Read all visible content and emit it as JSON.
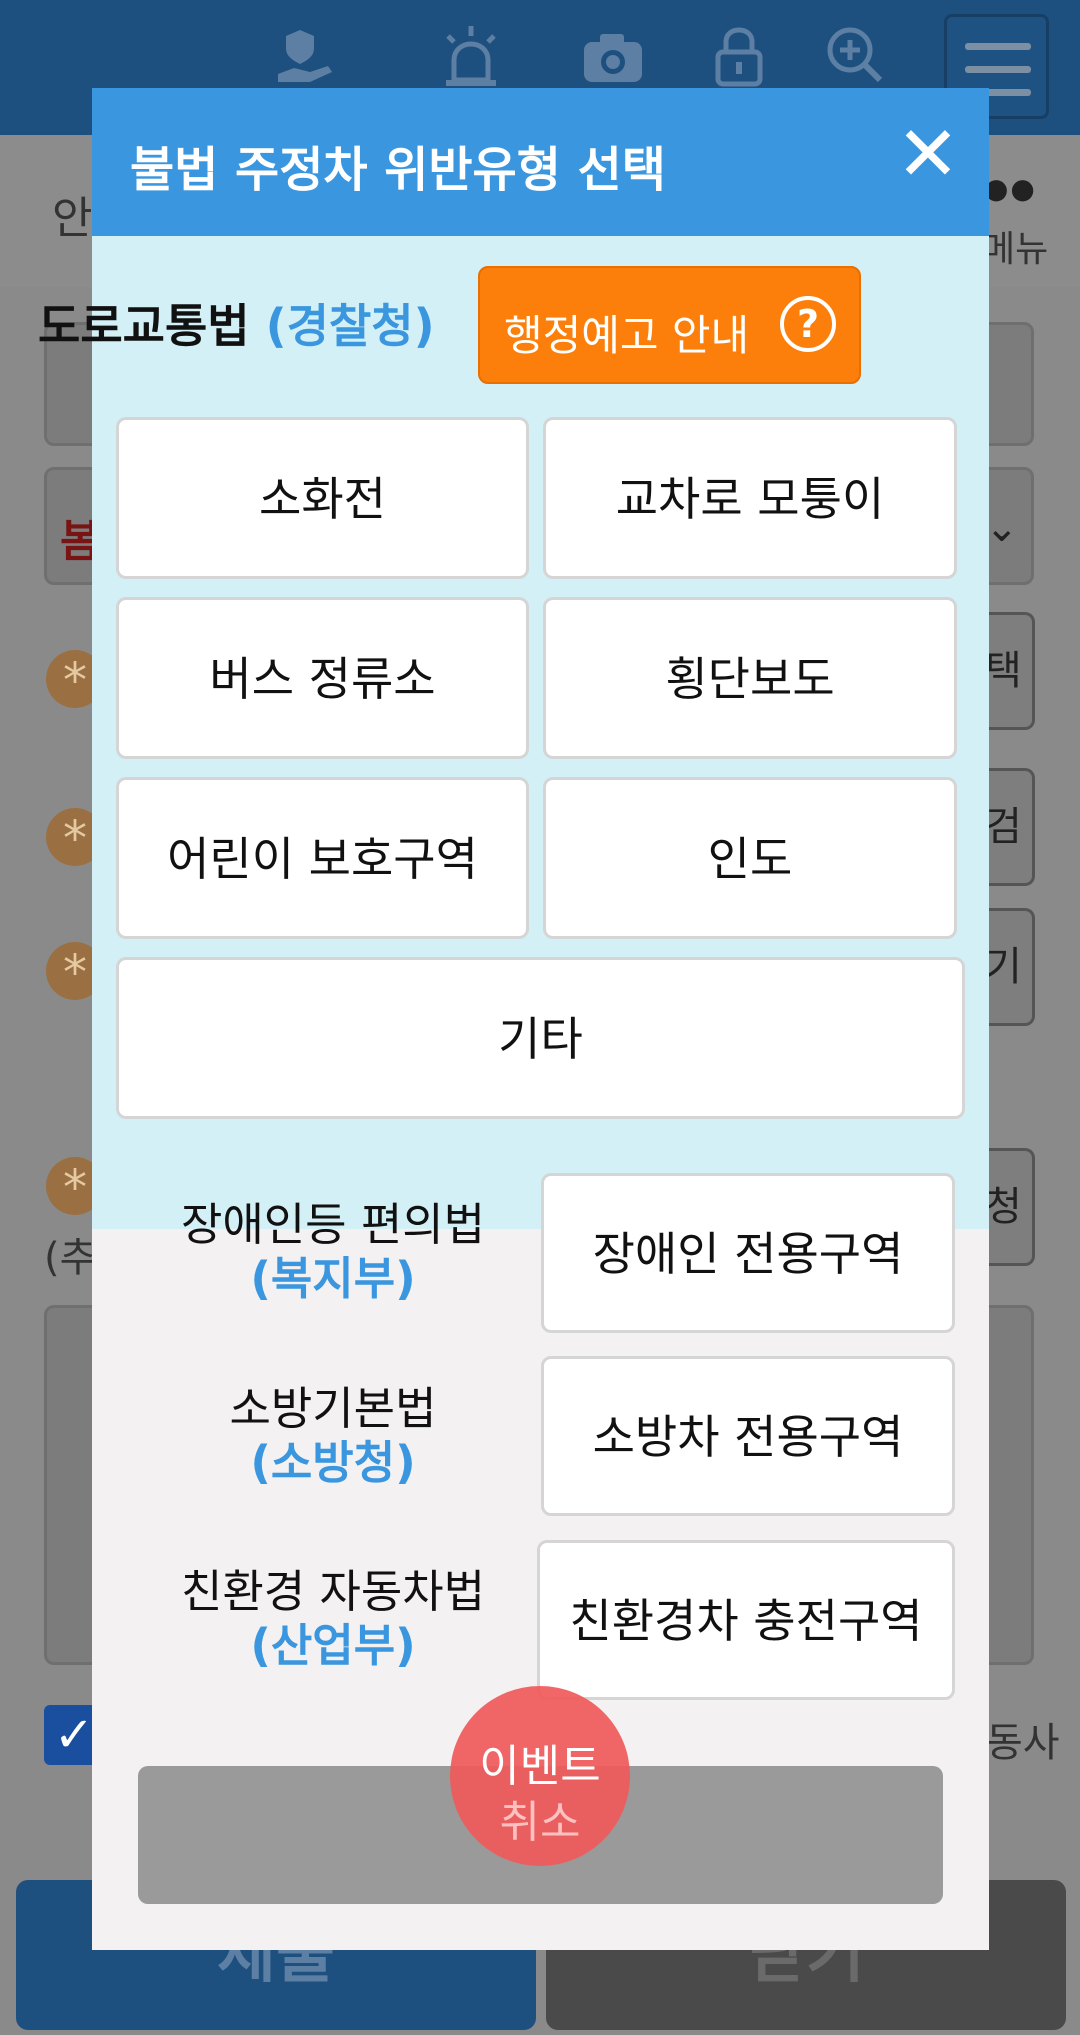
{
  "background": {
    "subbar_left": "안",
    "subbar_right": "메뉴",
    "red_text": "봄",
    "side_buttons": [
      "택",
      "검",
      "기",
      "청"
    ],
    "note": "(추",
    "right_text": "동사",
    "submit_label": "제출",
    "close_label": "닫기"
  },
  "modal": {
    "title": "불법 주정차 위반유형 선택",
    "close_symbol": "✕",
    "road_law": {
      "name": "도로교통법",
      "agency": "(경찰청)",
      "notice_label": "행정예고 안내",
      "help_symbol": "?",
      "options": [
        "소화전",
        "교차로 모퉁이",
        "버스 정류소",
        "횡단보도",
        "어린이 보호구역",
        "인도",
        "기타"
      ]
    },
    "other_laws": [
      {
        "name": "장애인등 편의법",
        "agency": "(복지부)",
        "option": "장애인 전용구역"
      },
      {
        "name": "소방기본법",
        "agency": "(소방청)",
        "option": "소방차 전용구역"
      },
      {
        "name": "친환경 자동차법",
        "agency": "(산업부)",
        "option": "친환경차 충전구역"
      }
    ],
    "event_line1": "이벤트",
    "event_line2": "취소"
  },
  "colors": {
    "header": "#3a97df",
    "accent_orange": "#fb7f0a",
    "section_bg": "#d4f0f7"
  }
}
